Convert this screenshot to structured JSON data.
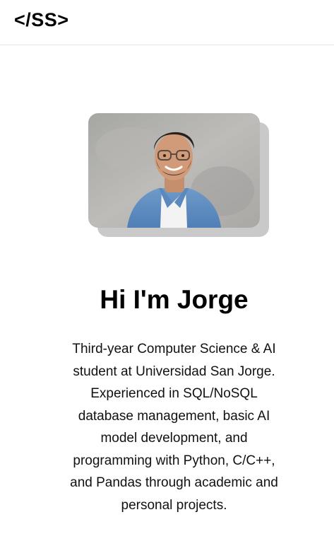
{
  "header": {
    "logo_text": "</SS>"
  },
  "hero": {
    "photo_alt": "Portrait photo",
    "title": "Hi I'm Jorge",
    "bio": "Third-year Computer Science & AI student at Universidad San Jorge. Experienced in SQL/NoSQL database management, basic AI model development, and programming with Python, C/C++, and Pandas through academic and personal projects."
  },
  "colors": {
    "background": "#ffffff",
    "text": "#000000",
    "photo_shadow": "#c9c9c9",
    "divider": "#e6e6e6"
  }
}
